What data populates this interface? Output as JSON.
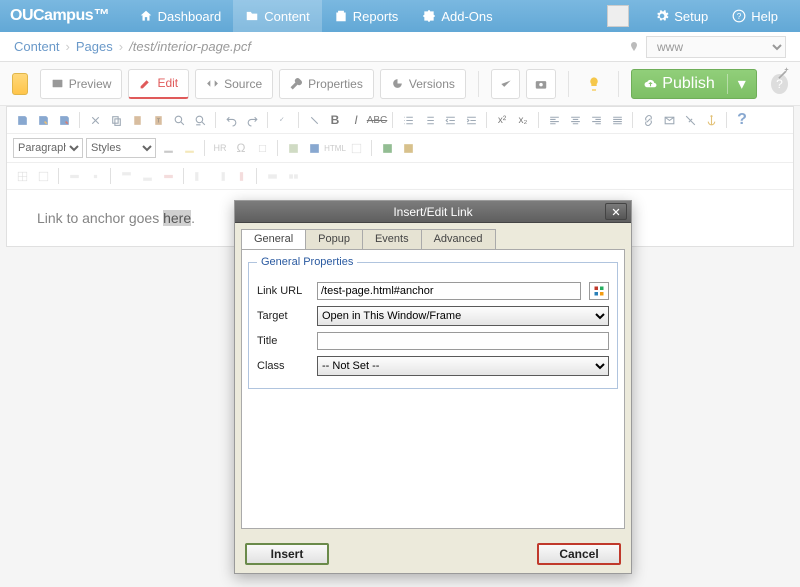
{
  "brand": "OUCampus",
  "topnav": {
    "dashboard": "Dashboard",
    "content": "Content",
    "reports": "Reports",
    "addons": "Add-Ons",
    "setup": "Setup",
    "help": "Help"
  },
  "breadcrumb": {
    "root": "Content",
    "pages": "Pages",
    "current": "/test/interior-page.pcf",
    "site": "www"
  },
  "pagetabs": {
    "preview": "Preview",
    "edit": "Edit",
    "source": "Source",
    "properties": "Properties",
    "versions": "Versions",
    "publish": "Publish"
  },
  "editor": {
    "format_select": "Paragraph",
    "styles_select": "Styles",
    "hr_label": "HR",
    "html_label": "HTML"
  },
  "content": {
    "line_prefix": "Link to anchor goes ",
    "line_sel": "here",
    "line_suffix": "."
  },
  "dialog": {
    "title": "Insert/Edit Link",
    "tabs": {
      "general": "General",
      "popup": "Popup",
      "events": "Events",
      "advanced": "Advanced"
    },
    "legend": "General Properties",
    "labels": {
      "url": "Link URL",
      "target": "Target",
      "title": "Title",
      "class": "Class"
    },
    "values": {
      "url": "/test-page.html#anchor",
      "target": "Open in This Window/Frame",
      "title": "",
      "class": "-- Not Set --"
    },
    "buttons": {
      "insert": "Insert",
      "cancel": "Cancel"
    }
  }
}
